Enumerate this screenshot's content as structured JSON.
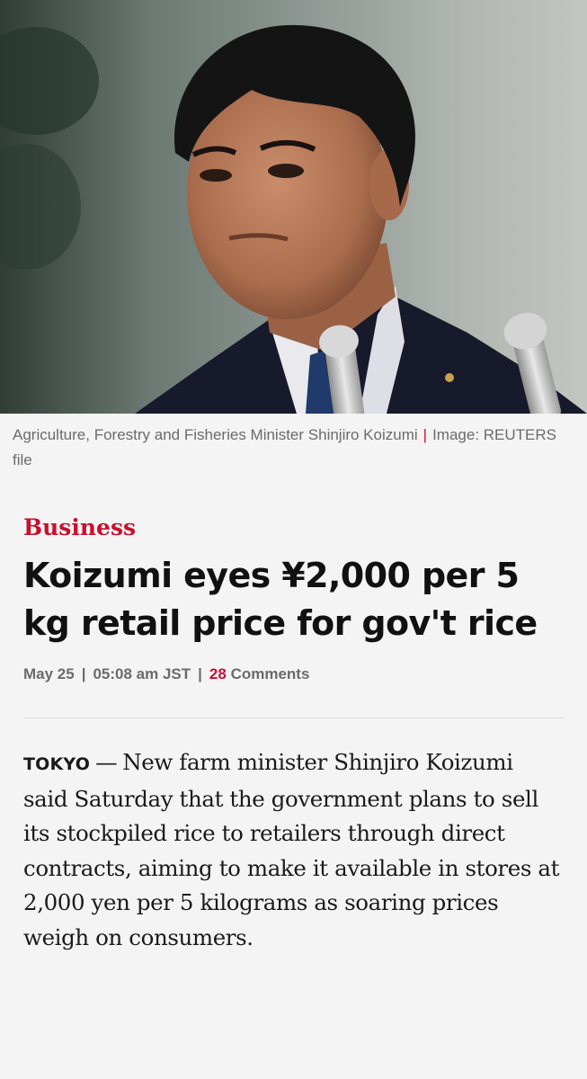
{
  "hero": {
    "image_description": "photo"
  },
  "caption": {
    "text": "Agriculture, Forestry and Fisheries Minister Shinjiro Koizumi",
    "separator": "|",
    "credit": "Image: REUTERS file"
  },
  "article": {
    "category": "Business",
    "headline": "Koizumi eyes ¥2,000 per 5 kg retail price for gov't rice",
    "meta": {
      "date": "May 25",
      "time": "05:08 am JST",
      "comment_count": "28",
      "comments_label": "Comments"
    },
    "dateline": "TOKYO",
    "dash": "—",
    "lead": "New farm minister Shinjiro Koizumi said Saturday that the government plans to sell its stockpiled rice to retailers through direct contracts, aiming to make it available in stores at 2,000 yen per 5 kilograms as soaring prices weigh on consumers."
  },
  "colors": {
    "accent": "#c8102e",
    "meta_gray": "#6b6b6b",
    "background": "#f4f4f4"
  }
}
